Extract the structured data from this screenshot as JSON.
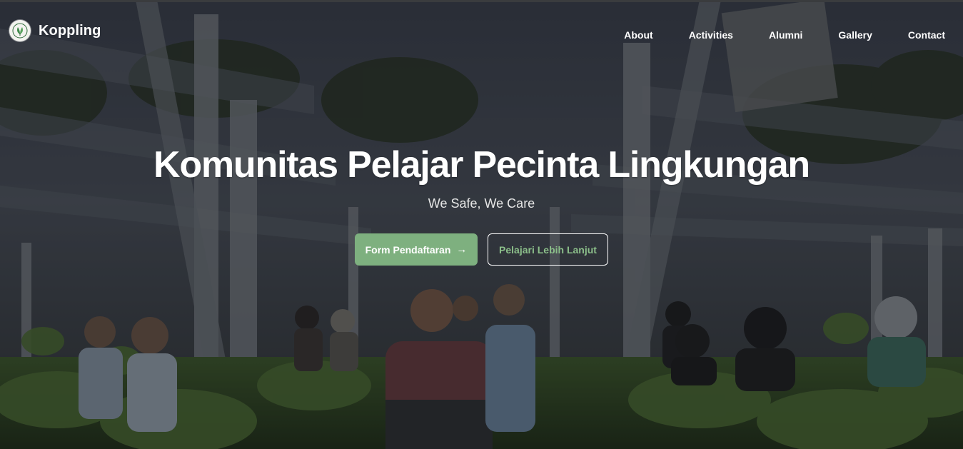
{
  "header": {
    "brand_name": "Koppling",
    "logo_icon": "leaf-emblem-icon",
    "nav": [
      {
        "label": "About"
      },
      {
        "label": "Activities"
      },
      {
        "label": "Alumni"
      },
      {
        "label": "Gallery"
      },
      {
        "label": "Contact"
      }
    ]
  },
  "hero": {
    "title": "Komunitas Pelajar Pecinta Lingkungan",
    "subtitle": "We Safe, We Care",
    "primary_cta": {
      "label": "Form Pendaftaran",
      "icon": "arrow-right-icon",
      "arrow": "→"
    },
    "secondary_cta": {
      "label": "Pelajari Lebih Lanjut"
    }
  },
  "colors": {
    "accent": "#7eb07f",
    "outline_text": "#8cbf8a",
    "text": "#ffffff"
  }
}
